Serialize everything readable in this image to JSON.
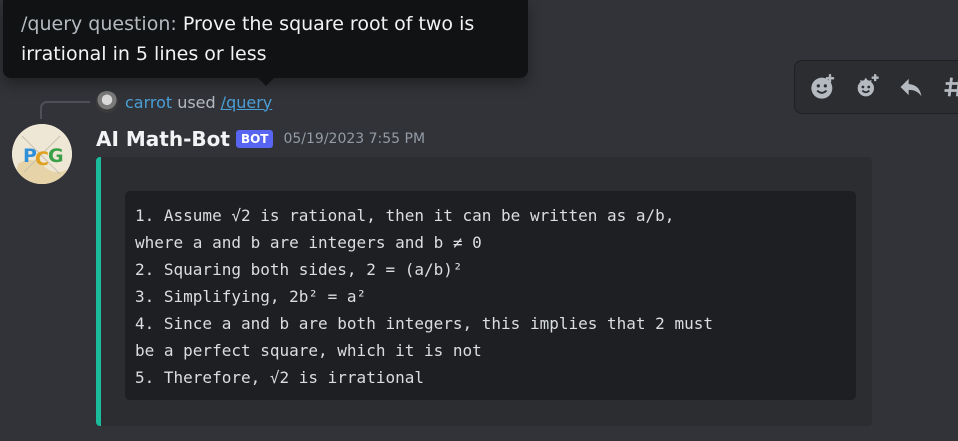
{
  "tooltip": {
    "prefix": "/query question:",
    "text": "Prove the square root of two is irrational in 5 lines or less"
  },
  "reply": {
    "username": "carrot",
    "used": "used",
    "command": "/query"
  },
  "message": {
    "username": "AI Math-Bot",
    "badge": "BOT",
    "timestamp": "05/19/2023 7:55 PM",
    "avatar_initials": "PCG",
    "embed_color": "#1abc9c",
    "code_lines": [
      "1. Assume √2 is rational, then it can be written as a/b,",
      "where a and b are integers and b ≠ 0",
      "2. Squaring both sides, 2 = (a/b)²",
      "3. Simplifying, 2b² = a²",
      "4. Since a and b are both integers, this implies that 2 must",
      "be a perfect square, which it is not",
      "5. Therefore, √2 is irrational"
    ]
  },
  "actions": [
    "add-reaction-icon",
    "add-super-reaction-icon",
    "reply-icon",
    "create-thread-icon"
  ]
}
